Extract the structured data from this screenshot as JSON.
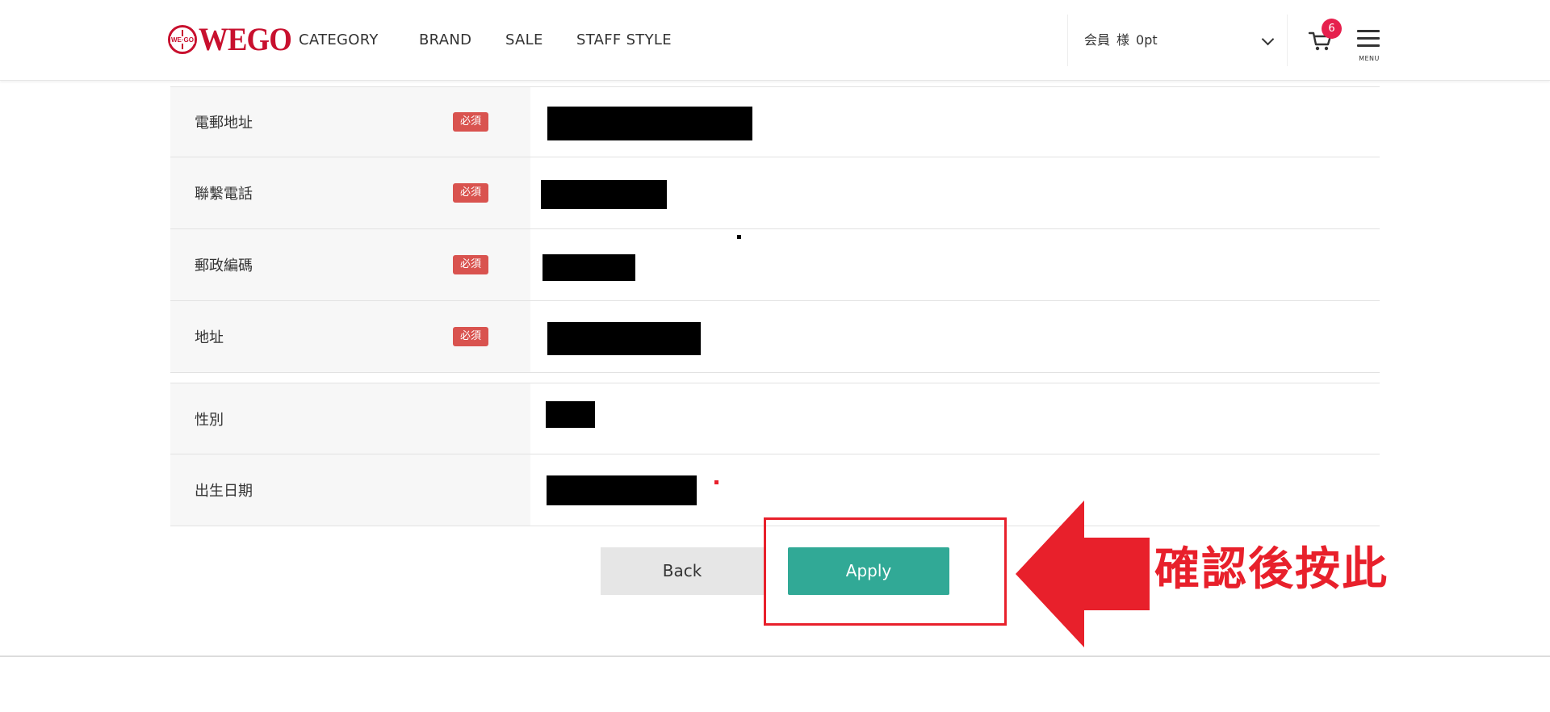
{
  "header": {
    "logo_mark_text": "WE·GO",
    "logo_text": "WEGO",
    "nav": [
      {
        "label": "CATEGORY"
      },
      {
        "label": "BRAND"
      },
      {
        "label": "SALE"
      },
      {
        "label": "STAFF STYLE"
      }
    ],
    "member": {
      "prefix": "会員",
      "suffix": "様",
      "points": "0pt"
    },
    "cart_count": "6",
    "menu_label": "MENU"
  },
  "form": {
    "rows": [
      {
        "label": "電郵地址",
        "required": "必須"
      },
      {
        "label": "聯繫電話",
        "required": "必須"
      },
      {
        "label": "郵政編碼",
        "required": "必須"
      },
      {
        "label": "地址",
        "required": "必須"
      },
      {
        "label": "性別"
      },
      {
        "label": "出生日期"
      }
    ]
  },
  "buttons": {
    "back": "Back",
    "apply": "Apply"
  },
  "annotation": {
    "text": "確認後按此"
  },
  "colors": {
    "brand": "#c8102e",
    "apply": "#31a996",
    "required_badge": "#d9534f",
    "cart_badge": "#e6204d",
    "annotation": "#e8202b"
  },
  "icons": [
    "cart-icon",
    "hamburger-menu-icon",
    "chevron-down-icon",
    "arrow-left-icon"
  ]
}
